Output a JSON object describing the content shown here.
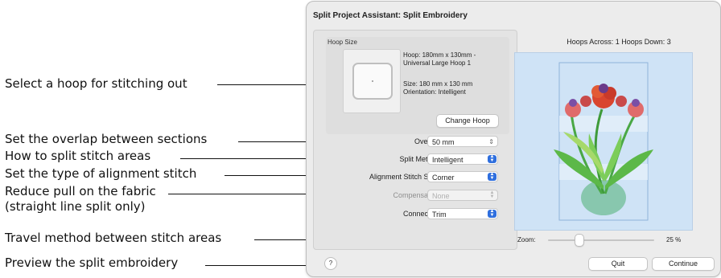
{
  "callouts": [
    "Select a hoop for stitching out",
    "Set the overlap between sections",
    "How to split stitch areas",
    "Set the type of alignment stitch",
    "Reduce pull on the fabric",
    "(straight line split only)",
    "Travel method between stitch areas",
    "Preview the split embroidery"
  ],
  "dialog": {
    "title": "Split Project Assistant: Split Embroidery",
    "hoop_group_label": "Hoop Size",
    "hoop_name_line1": "Hoop: 180mm x 130mm -",
    "hoop_name_line2": "Universal Large Hoop 1",
    "size_line": "Size: 180 mm x 130 mm",
    "orientation_line": "Orientation: Intelligent",
    "change_hoop_label": "Change Hoop",
    "overlap_label": "Overlap:",
    "overlap_value": "50 mm",
    "split_method_label": "Split Method:",
    "split_method_value": "Intelligent",
    "alignment_label": "Alignment Stitch Style:",
    "alignment_value": "Corner",
    "compensation_label": "Compensation:",
    "compensation_value": "None",
    "connection_label": "Connection:",
    "connection_value": "Trim",
    "hoops_across_label": "Hoops Across: 1",
    "hoops_down_label": "Hoops Down: 3",
    "zoom_label": "Zoom:",
    "zoom_value": "25 %",
    "zoom_level": 0.25,
    "help_label": "?",
    "quit_label": "Quit",
    "continue_label": "Continue"
  },
  "colors": {
    "accent": "#2f6fde",
    "preview_bg": "#cfe3f6",
    "dialog_bg": "#ececec"
  }
}
